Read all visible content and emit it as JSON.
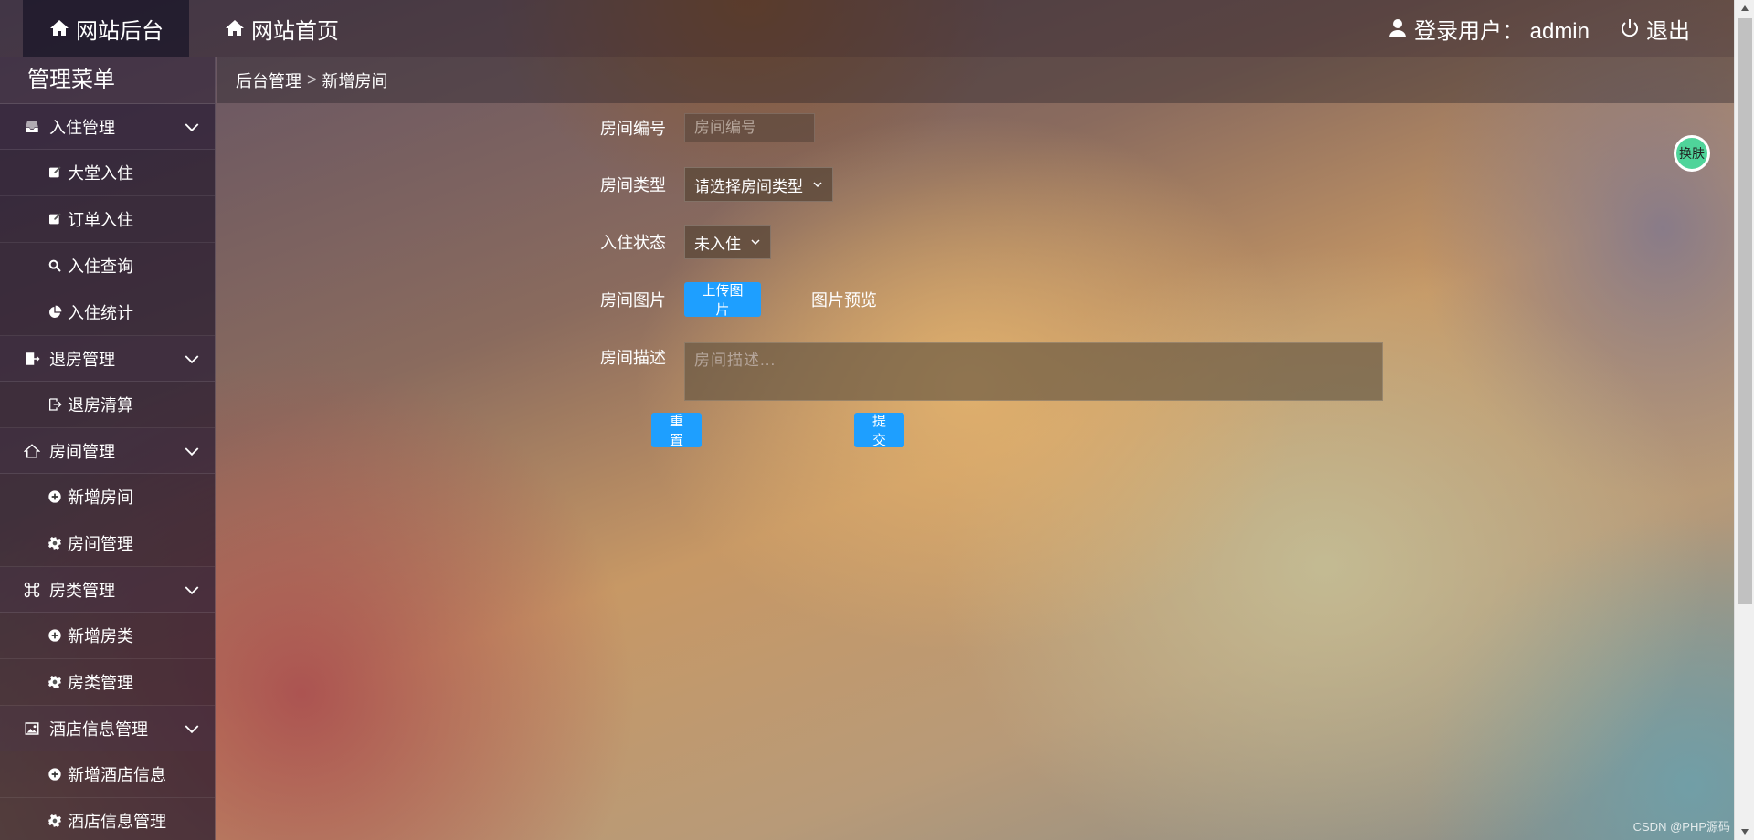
{
  "topbar": {
    "brand_label": "网站后台",
    "home_label": "网站首页",
    "user_label": "登录用户： admin",
    "logout_label": "退出"
  },
  "sidebar": {
    "title": "管理菜单",
    "groups": [
      {
        "label": "入住管理",
        "icon": "inbox-icon",
        "items": [
          {
            "label": "大堂入住",
            "icon": "edit-icon"
          },
          {
            "label": "订单入住",
            "icon": "edit-icon"
          },
          {
            "label": "入住查询",
            "icon": "search-icon"
          },
          {
            "label": "入住统计",
            "icon": "pie-chart-icon"
          }
        ]
      },
      {
        "label": "退房管理",
        "icon": "checkout-icon",
        "items": [
          {
            "label": "退房清算",
            "icon": "exit-icon"
          }
        ]
      },
      {
        "label": "房间管理",
        "icon": "house-icon",
        "items": [
          {
            "label": "新增房间",
            "icon": "plus-circle-icon"
          },
          {
            "label": "房间管理",
            "icon": "gear-icon"
          }
        ]
      },
      {
        "label": "房类管理",
        "icon": "command-icon",
        "items": [
          {
            "label": "新增房类",
            "icon": "plus-circle-icon"
          },
          {
            "label": "房类管理",
            "icon": "gear-icon"
          }
        ]
      },
      {
        "label": "酒店信息管理",
        "icon": "image-icon",
        "items": [
          {
            "label": "新增酒店信息",
            "icon": "plus-circle-icon"
          },
          {
            "label": "酒店信息管理",
            "icon": "gear-icon"
          }
        ]
      }
    ]
  },
  "breadcrumb": {
    "root": "后台管理",
    "separator": ">",
    "current": "新增房间"
  },
  "form": {
    "room_no_label": "房间编号",
    "room_no_placeholder": "房间编号",
    "room_type_label": "房间类型",
    "room_type_value": "请选择房间类型",
    "checkin_status_label": "入住状态",
    "checkin_status_value": "未入住",
    "room_image_label": "房间图片",
    "upload_label": "上传图片",
    "preview_label": "图片预览",
    "room_desc_label": "房间描述",
    "room_desc_placeholder": "房间描述...",
    "reset_label": "重置",
    "submit_label": "提交"
  },
  "skin_label": "换肤",
  "watermark": "CSDN @PHP源码"
}
